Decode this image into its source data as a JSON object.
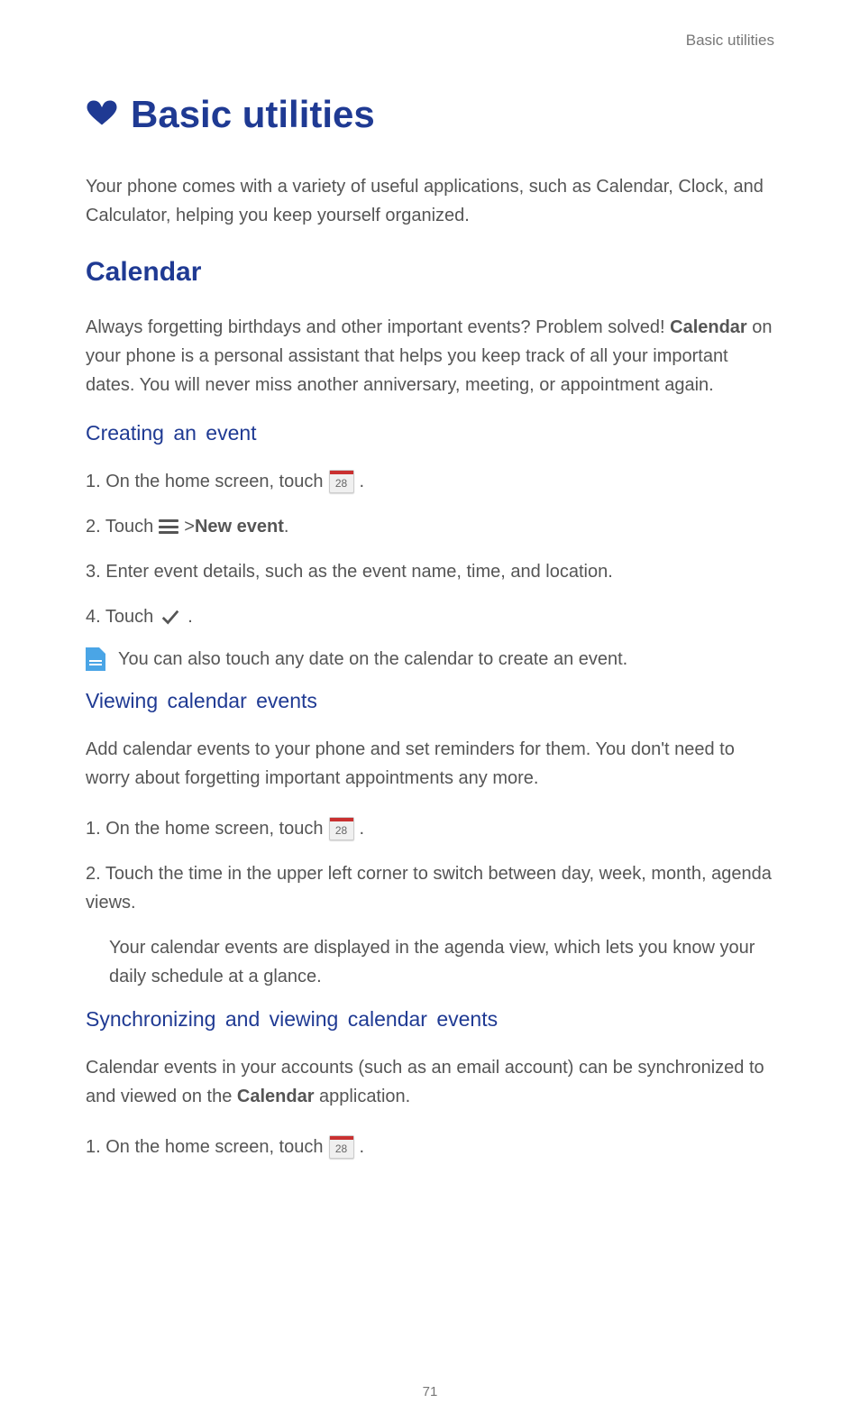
{
  "header": {
    "label": "Basic utilities"
  },
  "chapter": {
    "title": "Basic utilities"
  },
  "intro": "Your phone comes with a variety of useful applications, such as Calendar, Clock, and Calculator, helping you keep yourself organized.",
  "section": {
    "title": "Calendar",
    "intro_a": "Always forgetting birthdays and other important events? Problem solved! ",
    "intro_bold": "Calendar",
    "intro_b": " on your phone is a personal assistant that helps you keep track of all your important dates. You will never miss another anniversary, meeting, or appointment again."
  },
  "sub1": {
    "title": "Creating an event",
    "step1_a": "1. On the home screen, touch ",
    "step1_b": " .",
    "step2_a": "2. Touch ",
    "step2_b": "  > ",
    "step2_bold": "New event",
    "step2_c": ".",
    "step3": "3. Enter event details, such as the event name, time, and location.",
    "step4_a": "4. Touch ",
    "step4_b": ".",
    "note": "You can also touch any date on the calendar to create an event."
  },
  "sub2": {
    "title": "Viewing calendar events",
    "intro": "Add calendar events to your phone and set reminders for them. You don't need to worry about forgetting important appointments any more.",
    "step1_a": "1. On the home screen, touch ",
    "step1_b": " .",
    "step2": "2. Touch the time in the upper left corner to switch between day, week, month, agenda views.",
    "step2_sub": "Your calendar events are displayed in the agenda view, which lets you know your daily schedule at a glance."
  },
  "sub3": {
    "title": "Synchronizing and viewing calendar events",
    "intro_a": "Calendar events in your accounts (such as an email account) can be synchronized to and viewed on the ",
    "intro_bold": "Calendar",
    "intro_b": " application.",
    "step1_a": "1. On the home screen, touch ",
    "step1_b": " ."
  },
  "icons": {
    "cal_num": "28"
  },
  "page_number": "71"
}
